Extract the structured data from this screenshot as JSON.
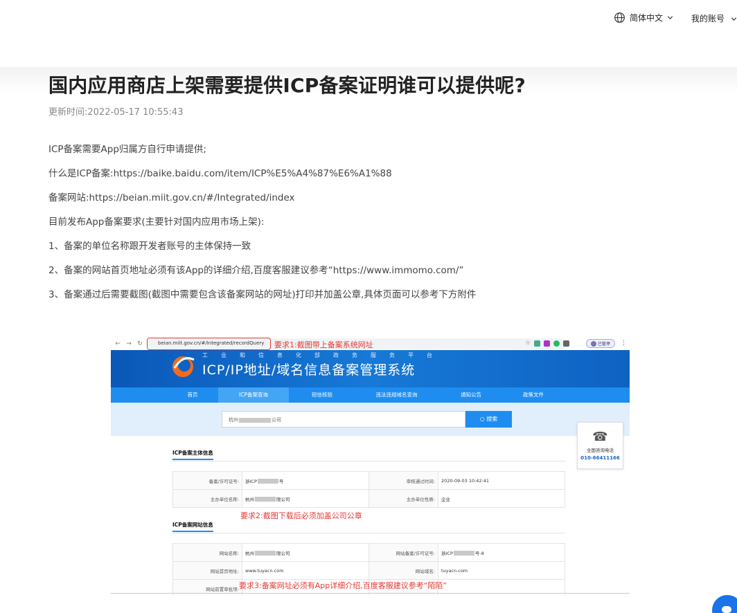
{
  "header": {
    "language_label": "简体中文",
    "account_label": "我的账号"
  },
  "article": {
    "title": "国内应用商店上架需要提供ICP备案证明谁可以提供呢?",
    "updated_label": "更新时间:",
    "updated_time": "2022-05-17 10:55:43",
    "paragraphs": [
      "ICP备案需要App归属方自行申请提供;",
      "什么是ICP备案:https://baike.baidu.com/item/ICP%E5%A4%87%E6%A1%88",
      "备案网站:https://beian.miit.gov.cn/#/Integrated/index",
      "目前发布App备案要求(主要针对国内应用市场上架):",
      "1、备案的单位名称跟开发者账号的主体保持一致",
      "2、备案的网站首页地址必须有该App的详细介绍,百度客服建议参考“https://www.immomo.com/”",
      "3、备案通过后需要截图(截图中需要包含该备案网站的网址)打印并加盖公章,具体页面可以参考下方附件"
    ]
  },
  "screenshot": {
    "url": "beian.miit.gov.cn/#/Integrated/recordQuery",
    "profile_label": "已暂停",
    "annotations": {
      "req1": "要求1:截图带上备案系统网址",
      "req2": "要求2:截图下载后必须加盖公司公章",
      "req3": "要求3:备案网址必须有App详细介绍,百度客服建议参考“陌陌”"
    },
    "banner_sub": "工业和信息化部政务服务平台",
    "banner_title": "ICP/IP地址/域名信息备案管理系统",
    "menu": [
      "首页",
      "ICP备案查询",
      "短信核验",
      "违法违规域名查询",
      "通知公告",
      "政策文件"
    ],
    "search_prefix": "杭州",
    "search_suffix": "公司",
    "search_button": "搜索",
    "phone_label": "全国咨询电话",
    "phone_number": "010-66411166",
    "subject_section": "ICP备案主体信息",
    "subject_rows": [
      {
        "k1": "备案/许可证号:",
        "v1": "浙ICP",
        "v1b": "号",
        "k2": "审核通过时间:",
        "v2": "2020-09-03 10:42:41"
      },
      {
        "k1": "主办单位名称:",
        "v1": "杭州",
        "v1b": "限公司",
        "k2": "主办单位性质:",
        "v2": "企业"
      }
    ],
    "site_section": "ICP备案网站信息",
    "site_rows": [
      {
        "k1": "网站名称:",
        "v1": "杭州",
        "v1b": "限公司",
        "k2": "网站备案/许可证号:",
        "v2": "浙ICP",
        "v2b": "号-8"
      },
      {
        "k1": "网站首页地址:",
        "v1": "www.tuyacn.com",
        "k2": "网站域名:",
        "v2": "tuyacn.com"
      },
      {
        "k1": "网站前置审批项:",
        "v1": "",
        "k2": "",
        "v2": ""
      }
    ]
  },
  "colors": {
    "brand_blue": "#1f8df0",
    "annotation_red": "#e53935"
  }
}
